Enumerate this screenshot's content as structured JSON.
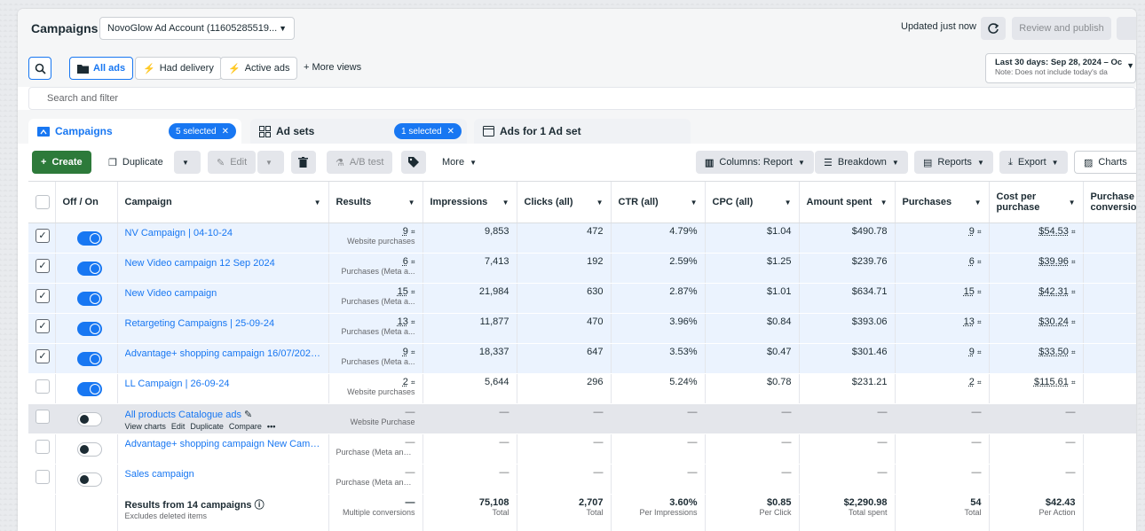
{
  "header": {
    "title": "Campaigns",
    "account": "NovoGlow Ad Account (11605285519...",
    "updated": "Updated just now",
    "review_publish": "Review and publish"
  },
  "views": {
    "all_ads": "All ads",
    "had_delivery": "Had delivery",
    "active_ads": "Active ads",
    "more_views": "+ More views",
    "date_range": "Last 30 days: Sep 28, 2024 – Oc",
    "date_note": "Note: Does not include today's da"
  },
  "search": {
    "placeholder": "Search and filter"
  },
  "tabs": {
    "campaigns": "Campaigns",
    "campaigns_chip": "5 selected",
    "adsets": "Ad sets",
    "adsets_chip": "1 selected",
    "ads": "Ads for 1 Ad set"
  },
  "toolbar": {
    "create": "Create",
    "duplicate": "Duplicate",
    "edit": "Edit",
    "ab_test": "A/B test",
    "more": "More",
    "columns": "Columns: Report",
    "breakdown": "Breakdown",
    "reports": "Reports",
    "export": "Export",
    "charts": "Charts"
  },
  "columns": {
    "onoff": "Off / On",
    "campaign": "Campaign",
    "results": "Results",
    "impressions": "Impressions",
    "clicks": "Clicks (all)",
    "ctr": "CTR (all)",
    "cpc": "CPC (all)",
    "amount": "Amount spent",
    "purchases": "Purchases",
    "cost_per": "Cost per purchase",
    "purch_conv": "Purchase conversion"
  },
  "rows": [
    {
      "name": "NV Campaign | 04-10-24",
      "results": "9",
      "results_sub": "Website purchases",
      "impressions": "9,853",
      "clicks": "472",
      "ctr": "4.79%",
      "cpc": "$1.04",
      "amount": "$490.78",
      "purchases": "9",
      "cost": "$54.53"
    },
    {
      "name": "New Video campaign 12 Sep 2024",
      "results": "6",
      "results_sub": "Purchases (Meta a...",
      "impressions": "7,413",
      "clicks": "192",
      "ctr": "2.59%",
      "cpc": "$1.25",
      "amount": "$239.76",
      "purchases": "6",
      "cost": "$39.96"
    },
    {
      "name": "New Video campaign",
      "results": "15",
      "results_sub": "Purchases (Meta a...",
      "impressions": "21,984",
      "clicks": "630",
      "ctr": "2.87%",
      "cpc": "$1.01",
      "amount": "$634.71",
      "purchases": "15",
      "cost": "$42.31"
    },
    {
      "name": "Retargeting Campaigns | 25-09-24",
      "results": "13",
      "results_sub": "Purchases (Meta a...",
      "impressions": "11,877",
      "clicks": "470",
      "ctr": "3.96%",
      "cpc": "$0.84",
      "amount": "$393.06",
      "purchases": "13",
      "cost": "$30.24"
    },
    {
      "name": "Advantage+ shopping campaign 16/07/2024 ...",
      "results": "9",
      "results_sub": "Purchases (Meta a...",
      "impressions": "18,337",
      "clicks": "647",
      "ctr": "3.53%",
      "cpc": "$0.47",
      "amount": "$301.46",
      "purchases": "9",
      "cost": "$33.50"
    },
    {
      "name": "LL Campaign | 26-09-24",
      "results": "2",
      "results_sub": "Website purchases",
      "impressions": "5,644",
      "clicks": "296",
      "ctr": "5.24%",
      "cpc": "$0.78",
      "amount": "$231.21",
      "purchases": "2",
      "cost": "$115.61"
    },
    {
      "name": "All products Catalogue ads",
      "results": "—",
      "results_sub": "Website Purchase",
      "impressions": "—",
      "clicks": "—",
      "ctr": "—",
      "cpc": "—",
      "amount": "—",
      "purchases": "—",
      "cost": "—"
    },
    {
      "name": "Advantage+ shopping campaign New Campaign",
      "results": "—",
      "results_sub": "Purchase (Meta and w...",
      "impressions": "—",
      "clicks": "—",
      "ctr": "—",
      "cpc": "—",
      "amount": "—",
      "purchases": "—",
      "cost": "—"
    },
    {
      "name": "Sales campaign",
      "results": "—",
      "results_sub": "Purchase (Meta and w...",
      "impressions": "—",
      "clicks": "—",
      "ctr": "—",
      "cpc": "—",
      "amount": "—",
      "purchases": "—",
      "cost": "—"
    }
  ],
  "row_actions": {
    "view_charts": "View charts",
    "edit": "Edit",
    "duplicate": "Duplicate",
    "compare": "Compare",
    "more": "•••"
  },
  "totals": {
    "label": "Results from 14 campaigns",
    "label_sub": "Excludes deleted items",
    "results": "—",
    "results_sub": "Multiple conversions",
    "impressions": "75,108",
    "impressions_sub": "Total",
    "clicks": "2,707",
    "clicks_sub": "Total",
    "ctr": "3.60%",
    "ctr_sub": "Per Impressions",
    "cpc": "$0.85",
    "cpc_sub": "Per Click",
    "amount": "$2,290.98",
    "amount_sub": "Total spent",
    "purchases": "54",
    "purchases_sub": "Total",
    "cost": "$42.43",
    "cost_sub": "Per Action"
  }
}
